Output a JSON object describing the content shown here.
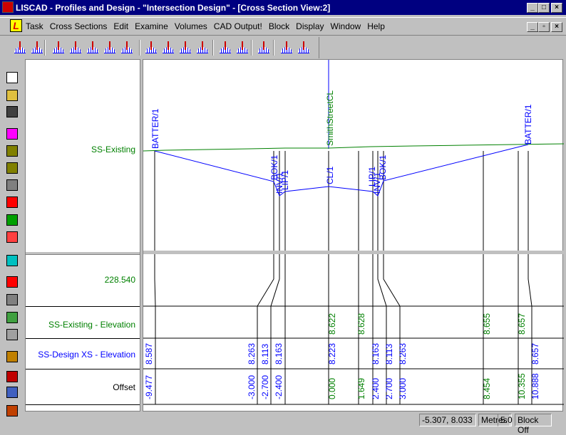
{
  "window": {
    "title": "LISCAD - Profiles and Design - \"Intersection Design\" - [Cross Section View:2]",
    "controls": [
      "_",
      "□",
      "×"
    ],
    "child_controls": [
      "_",
      "▫",
      "×"
    ]
  },
  "menu": {
    "logo": "L",
    "items": [
      "Task",
      "Cross Sections",
      "Edit",
      "Examine",
      "Volumes",
      "CAD Output!",
      "Block",
      "Display",
      "Window",
      "Help"
    ]
  },
  "toolbar": {
    "icons": [
      "open-template-icon",
      "select-template-icon",
      "insert-point-icon",
      "raise-point-icon",
      "lower-point-icon",
      "move-point-icon",
      "delete-point-icon",
      "edit-feature-icon",
      "delete-offset-icon",
      "delete-range-icon",
      "report-icon",
      "zoom-window-icon",
      "zoom-extents-icon",
      "surface-icon",
      "level-icon",
      "profile-report-icon"
    ]
  },
  "left_toolbar": {
    "icons": [
      {
        "name": "new-icon",
        "color": "#ffffff"
      },
      {
        "name": "open-icon",
        "color": "#e0c040"
      },
      {
        "name": "save-icon",
        "color": "#404040"
      },
      {
        "name": "pan-icon",
        "color": "#ff00ff"
      },
      {
        "name": "zoom-in-icon",
        "color": "#808000"
      },
      {
        "name": "zoom-out-icon",
        "color": "#808000"
      },
      {
        "name": "window-icon",
        "color": "#808080"
      },
      {
        "name": "layers-icon",
        "color": "#ff0000"
      },
      {
        "name": "pencil-icon",
        "color": "#00a000"
      },
      {
        "name": "copy-icon",
        "color": "#ff4040"
      },
      {
        "name": "calculator-icon",
        "color": "#00c0c0"
      },
      {
        "name": "warning-icon",
        "color": "#ff0000"
      },
      {
        "name": "block-icon",
        "color": "#808080"
      },
      {
        "name": "hatch-icon",
        "color": "#40a040"
      },
      {
        "name": "disabled-icon",
        "color": "#a0a0a0"
      },
      {
        "name": "tools-icon",
        "color": "#c08000"
      },
      {
        "name": "people-icon",
        "color": "#c00000"
      },
      {
        "name": "table-icon",
        "color": "#4060c0"
      },
      {
        "name": "pattern-icon",
        "color": "#c04000"
      }
    ]
  },
  "colors": {
    "existing": "#008000",
    "design": "#0000ff",
    "title_bar": "#000080"
  },
  "labels": {
    "existing_surface": "SS-Existing",
    "datum": "228.540",
    "existing_elevation": "SS-Existing - Elevation",
    "design_elevation": "SS-Design XS - Elevation",
    "offset": "Offset"
  },
  "features": [
    "BATTER/1",
    "BOK/1",
    "INV/1",
    "LIP/1",
    "SmithStreetCL",
    "CL/1",
    "LIP/1",
    "INV/1",
    "BOK/1",
    "BATTER/1"
  ],
  "existing_elevations": [
    "8.622",
    "8.628",
    "8.655",
    "8.657"
  ],
  "design_elevations": [
    "8.587",
    "8.263",
    "8.113",
    "8.163",
    "8.223",
    "8.163",
    "8.113",
    "8.263",
    "8.657"
  ],
  "offsets": [
    {
      "value": "-9.477",
      "color": "#0000ff"
    },
    {
      "value": "-3.000",
      "color": "#0000ff"
    },
    {
      "value": "-2.700",
      "color": "#0000ff"
    },
    {
      "value": "-2.400",
      "color": "#0000ff"
    },
    {
      "value": "0.000",
      "color": "#008000"
    },
    {
      "value": "1.649",
      "color": "#008000"
    },
    {
      "value": "2.400",
      "color": "#0000ff"
    },
    {
      "value": "2.700",
      "color": "#0000ff"
    },
    {
      "value": "3.000",
      "color": "#0000ff"
    },
    {
      "value": "8.454",
      "color": "#008000"
    },
    {
      "value": "10.355",
      "color": "#008000"
    },
    {
      "value": "10.888",
      "color": "#0000ff"
    }
  ],
  "status": {
    "coords": "-5.307, 8.033",
    "units": "Metres",
    "scale": "5.0",
    "block": "Block Off"
  }
}
